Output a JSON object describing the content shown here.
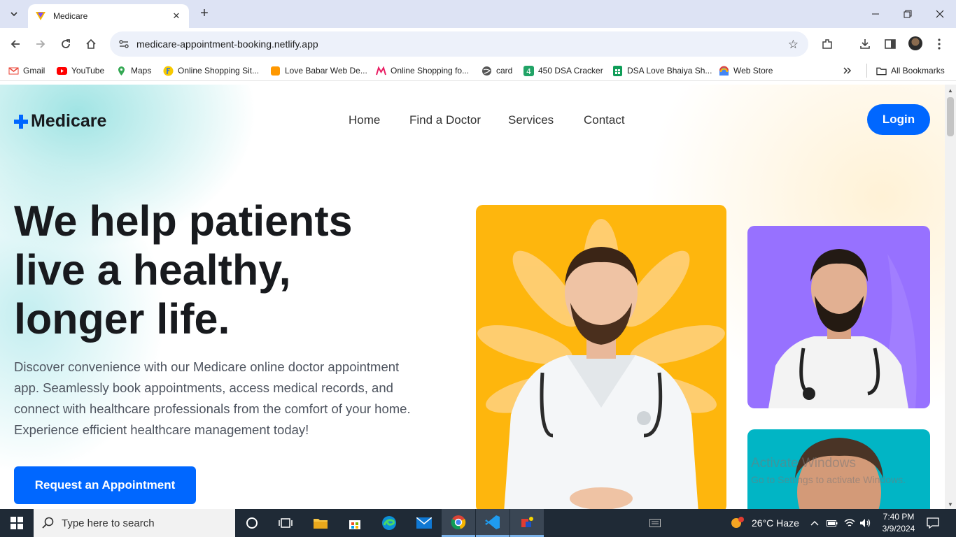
{
  "browser": {
    "tab_title": "Medicare",
    "url": "medicare-appointment-booking.netlify.app",
    "bookmarks": [
      {
        "label": "Gmail",
        "color": "#ea4335"
      },
      {
        "label": "YouTube",
        "color": "#ff0000"
      },
      {
        "label": "Maps",
        "color": "#34a853"
      },
      {
        "label": "Online Shopping Sit...",
        "color": "#f7c900"
      },
      {
        "label": "Love Babar Web De...",
        "color": "#ff9800"
      },
      {
        "label": "Online Shopping fo...",
        "color": "#e91e63"
      },
      {
        "label": "card",
        "color": "#555555"
      },
      {
        "label": "450 DSA Cracker",
        "color": "#21a366"
      },
      {
        "label": "DSA Love Bhaiya Sh...",
        "color": "#0f9d58"
      },
      {
        "label": "Web Store",
        "color": "#ea4335"
      }
    ],
    "all_bookmarks": "All Bookmarks"
  },
  "site": {
    "brand": "Medicare",
    "nav": [
      "Home",
      "Find a Doctor",
      "Services",
      "Contact"
    ],
    "login": "Login",
    "hero_title_lines": [
      "We help patients",
      "live a healthy,",
      "longer life."
    ],
    "hero_description": "Discover convenience with our Medicare online doctor appointment app. Seamlessly book appointments, access medical records, and connect with healthcare professionals from the comfort of your home. Experience efficient healthcare management today!",
    "cta": "Request an Appointment",
    "colors": {
      "primary": "#0067ff",
      "yellow": "#feb60d",
      "purple": "#9771ff",
      "teal": "#01b5c5"
    }
  },
  "watermark": {
    "line1": "Activate Windows",
    "line2": "Go to Settings to activate Windows."
  },
  "taskbar": {
    "search_placeholder": "Type here to search",
    "weather": "26°C  Haze",
    "time": "7:40 PM",
    "date": "3/9/2024"
  }
}
